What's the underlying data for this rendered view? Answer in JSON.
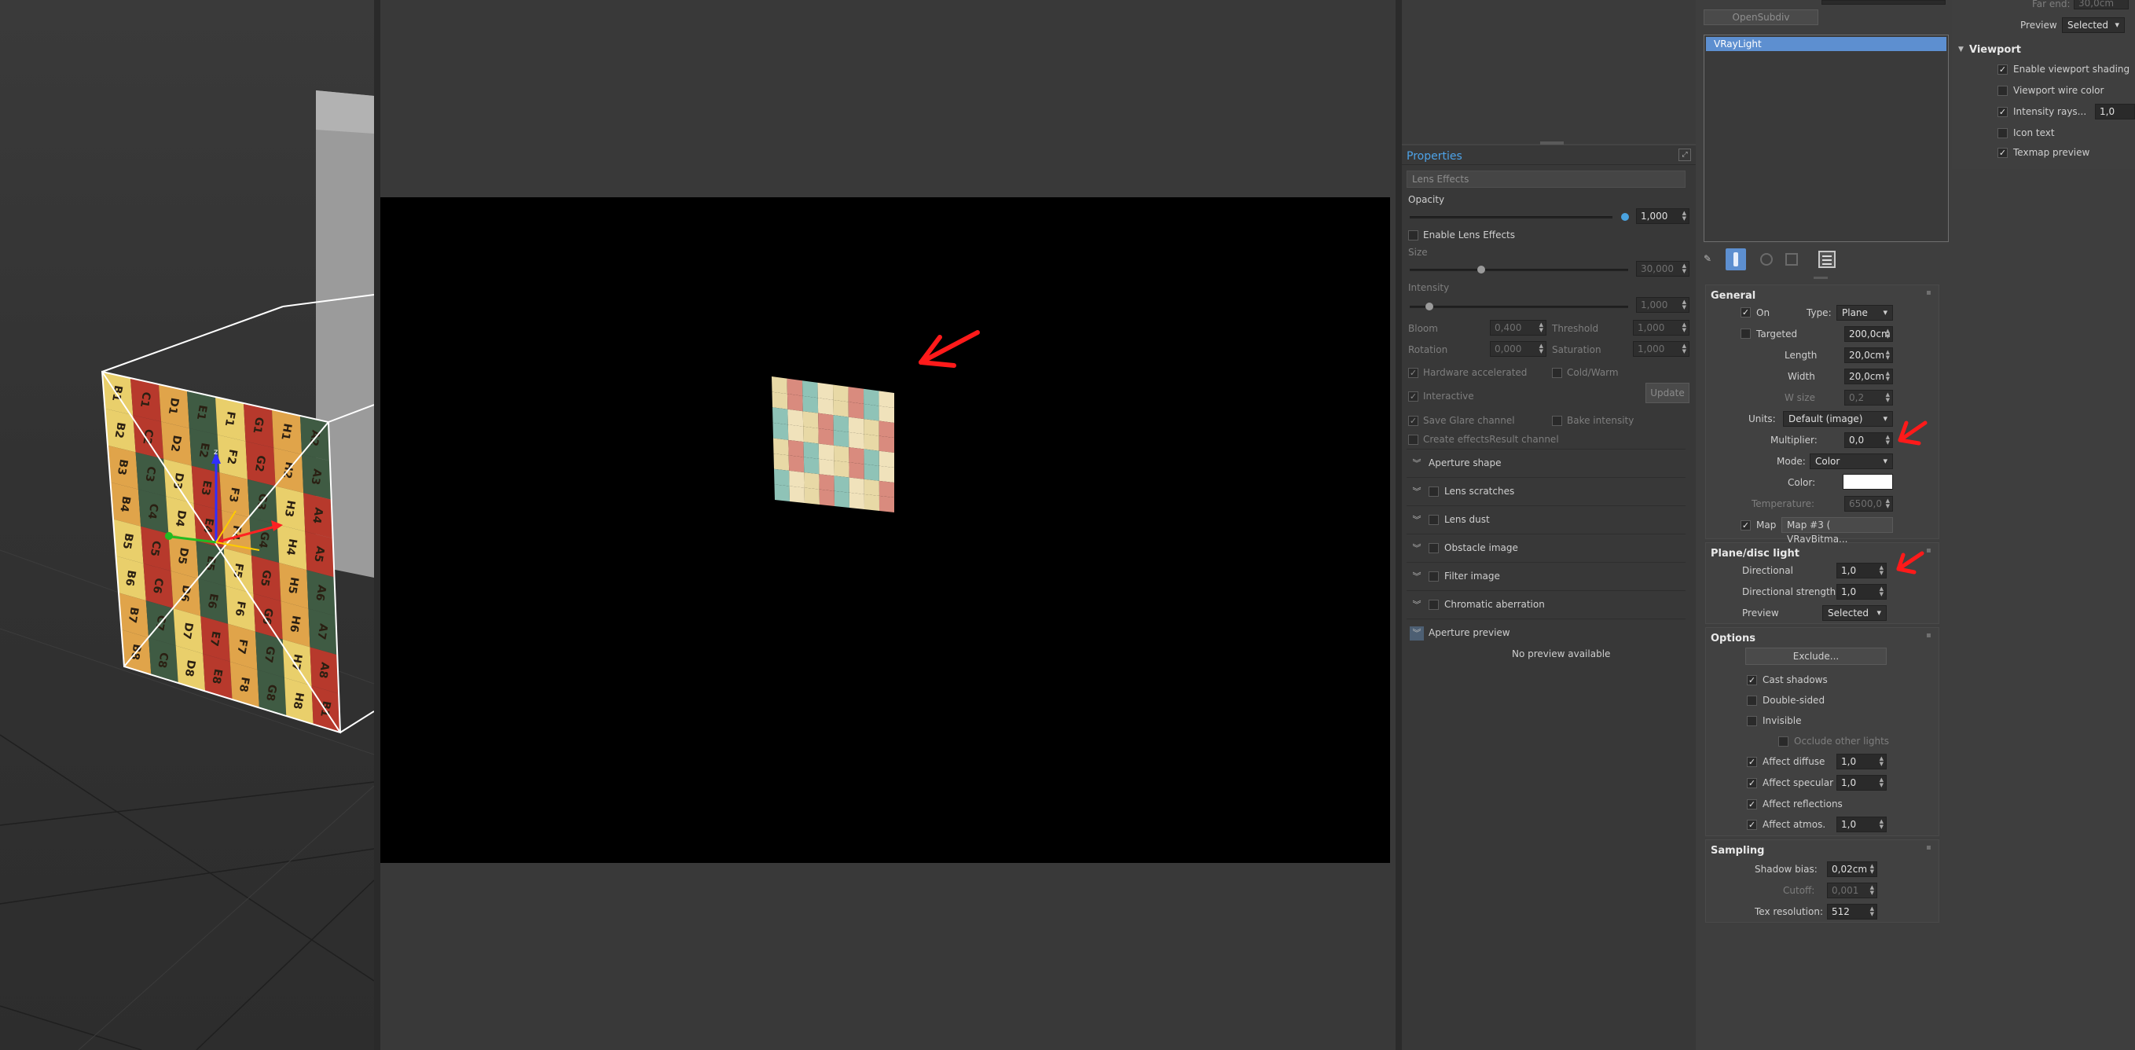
{
  "viewport": {
    "board_labels": [
      "B1",
      "C1",
      "D1",
      "E1",
      "F1",
      "G1",
      "H1",
      "A2",
      "B2",
      "C2",
      "D2",
      "E2",
      "F2",
      "G2",
      "H2",
      "A3",
      "B3",
      "C3",
      "D3",
      "E3",
      "F3",
      "G3",
      "H3",
      "A4",
      "B4",
      "C4",
      "D4",
      "E4",
      "F4",
      "G4",
      "H4",
      "A5",
      "B5",
      "C5",
      "D5",
      "E5",
      "F5",
      "G5",
      "H5",
      "A6",
      "B6",
      "C6",
      "D6",
      "E6",
      "F6",
      "G6",
      "H6",
      "A7",
      "B7",
      "C7",
      "D7",
      "E7",
      "F7",
      "G7",
      "H7",
      "A8",
      "B8",
      "C8",
      "D8",
      "E8",
      "F8",
      "G8",
      "H8"
    ]
  },
  "properties": {
    "title": "Properties",
    "lens_effects_header": "Lens Effects",
    "opacity": {
      "label": "Opacity",
      "value": "1,000"
    },
    "enable_lens_effects": {
      "label": "Enable Lens Effects",
      "checked": false
    },
    "size": {
      "label": "Size",
      "value": "30,000"
    },
    "intensity": {
      "label": "Intensity",
      "value": "1,000"
    },
    "bloom": {
      "label": "Bloom",
      "value": "0,400"
    },
    "threshold": {
      "label": "Threshold",
      "value": "1,000"
    },
    "rotation": {
      "label": "Rotation",
      "value": "0,000"
    },
    "saturation": {
      "label": "Saturation",
      "value": "1,000"
    },
    "hardware_accelerated": {
      "label": "Hardware accelerated",
      "checked": true
    },
    "cold_warm": {
      "label": "Cold/Warm",
      "checked": false
    },
    "interactive": {
      "label": "Interactive",
      "checked": true
    },
    "update_button": "Update",
    "save_glare_channel": {
      "label": "Save Glare channel",
      "checked": true
    },
    "bake_intensity": {
      "label": "Bake intensity",
      "checked": false
    },
    "create_effects_result": {
      "label": "Create effectsResult channel",
      "checked": false
    },
    "rollouts": [
      {
        "label": "Aperture shape",
        "checkbox": false
      },
      {
        "label": "Lens scratches",
        "checkbox": true
      },
      {
        "label": "Lens dust",
        "checkbox": true
      },
      {
        "label": "Obstacle image",
        "checkbox": true
      },
      {
        "label": "Filter image",
        "checkbox": true
      },
      {
        "label": "Chromatic aberration",
        "checkbox": true
      },
      {
        "label": "Aperture preview",
        "checkbox": false
      }
    ],
    "no_preview": "No preview available"
  },
  "command_panel": {
    "far_end": {
      "label": "Far end:",
      "value": "30,0cm"
    },
    "preview_top": {
      "label": "Preview",
      "value": "Selected"
    },
    "opensubdiv_button": "OpenSubdiv",
    "light_list": [
      "VRayLight"
    ],
    "viewport": {
      "title": "Viewport",
      "enable_viewport_shading": {
        "label": "Enable viewport shading",
        "checked": true
      },
      "viewport_wire_color": {
        "label": "Viewport wire color",
        "checked": false
      },
      "intensity_rays": {
        "label": "Intensity rays...",
        "checked": true,
        "value": "1,0"
      },
      "icon_text": {
        "label": "Icon text",
        "checked": false
      },
      "texmap_preview": {
        "label": "Texmap preview",
        "checked": true
      }
    },
    "general": {
      "title": "General",
      "on": {
        "label": "On",
        "checked": true
      },
      "type": {
        "label": "Type:",
        "value": "Plane"
      },
      "targeted": {
        "label": "Targeted",
        "checked": false,
        "value": "200,0cm"
      },
      "length": {
        "label": "Length",
        "value": "20,0cm"
      },
      "width": {
        "label": "Width",
        "value": "20,0cm"
      },
      "w_size": {
        "label": "W size",
        "value": "0,2"
      },
      "units": {
        "label": "Units:",
        "value": "Default (image)"
      },
      "multiplier": {
        "label": "Multiplier:",
        "value": "0,0"
      },
      "mode": {
        "label": "Mode:",
        "value": "Color"
      },
      "color": {
        "label": "Color:",
        "swatch": "#ffffff"
      },
      "temperature": {
        "label": "Temperature:",
        "value": "6500,0"
      },
      "map": {
        "label": "Map",
        "checked": true,
        "value": "Map #3  ( VRayBitma..."
      }
    },
    "plane_disc": {
      "title": "Plane/disc light",
      "directional": {
        "label": "Directional",
        "value": "1,0"
      },
      "directional_strength": {
        "label": "Directional strength",
        "value": "1,0"
      },
      "preview": {
        "label": "Preview",
        "value": "Selected"
      }
    },
    "options": {
      "title": "Options",
      "exclude_button": "Exclude...",
      "cast_shadows": {
        "label": "Cast shadows",
        "checked": true
      },
      "double_sided": {
        "label": "Double-sided",
        "checked": false
      },
      "invisible": {
        "label": "Invisible",
        "checked": false
      },
      "occlude_other_lights": {
        "label": "Occlude other lights",
        "checked": false
      },
      "affect_diffuse": {
        "label": "Affect diffuse",
        "checked": true,
        "value": "1,0"
      },
      "affect_specular": {
        "label": "Affect specular",
        "checked": true,
        "value": "1,0"
      },
      "affect_reflections": {
        "label": "Affect reflections",
        "checked": true
      },
      "affect_atmos": {
        "label": "Affect atmos.",
        "checked": true,
        "value": "1,0"
      }
    },
    "sampling": {
      "title": "Sampling",
      "shadow_bias": {
        "label": "Shadow bias:",
        "value": "0,02cm"
      },
      "cutoff": {
        "label": "Cutoff:",
        "value": "0,001"
      },
      "tex_resolution": {
        "label": "Tex resolution:",
        "value": "512"
      }
    }
  },
  "colors": {
    "accent": "#4da3e8",
    "selection": "#5d8fd0",
    "annotation": "#ff1a1a"
  }
}
